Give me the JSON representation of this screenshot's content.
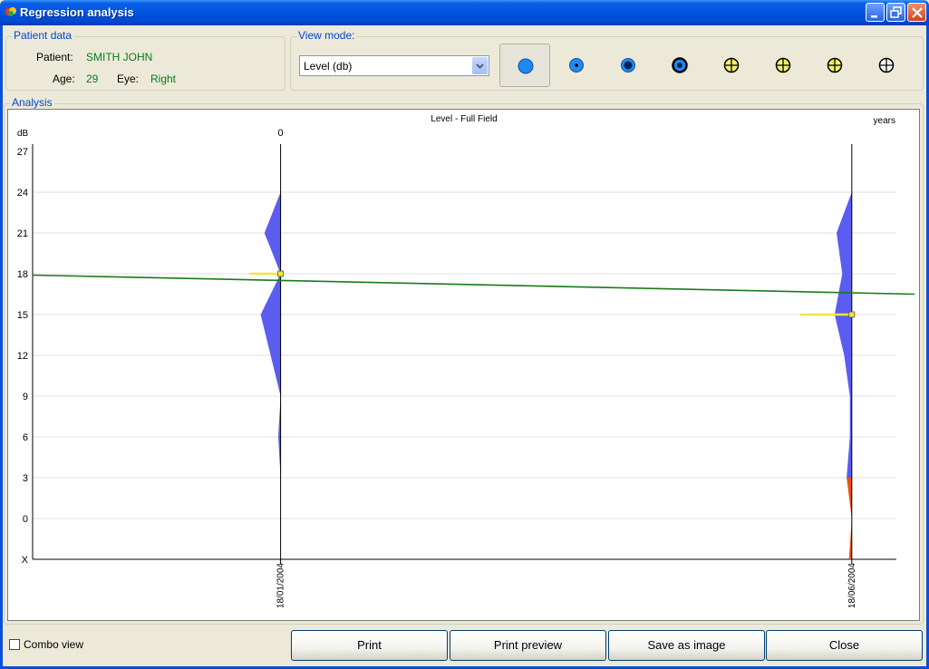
{
  "window": {
    "title": "Regression analysis"
  },
  "patient": {
    "group_label": "Patient data",
    "patient_label": "Patient:",
    "patient_name": "SMITH JOHN",
    "age_label": "Age:",
    "age_value": "29",
    "eye_label": "Eye:",
    "eye_value": "Right"
  },
  "view_mode": {
    "group_label": "View mode:",
    "selected": "Level (db)",
    "icons": [
      "circle-filled-icon",
      "circle-dot-icon",
      "circle-dark-center-icon",
      "circle-black-center-icon",
      "cross-circle-yellow-icon",
      "cross-circle-yellow-icon",
      "cross-circle-yellow-icon",
      "cross-circle-yellow-icon"
    ]
  },
  "analysis": {
    "group_label": "Analysis"
  },
  "chart_data": {
    "type": "line",
    "title": "Level - Full Field",
    "ylabel": "dB",
    "xlabel": "years",
    "top_left_tick": "0",
    "y_ticks": [
      "27",
      "24",
      "21",
      "18",
      "15",
      "12",
      "9",
      "6",
      "3",
      "0",
      "X"
    ],
    "ylim": [
      -3,
      27
    ],
    "grid": true,
    "x_dates": [
      "18/01/2004",
      "18/06/2004"
    ],
    "x_years": [
      0,
      0.41
    ],
    "x_range_years": [
      -0.178,
      0.455
    ],
    "regression_line": {
      "color": "#1a7a1a",
      "y_at_left_edge": 17.9,
      "y_at_right_edge": 16.5
    },
    "series_mean": [
      {
        "date": "18/01/2004",
        "value": 18
      },
      {
        "date": "18/06/2004",
        "value": 15
      }
    ],
    "distributions": [
      {
        "date": "18/01/2004",
        "blue_profile": [
          [
            24,
            0
          ],
          [
            21,
            1.7
          ],
          [
            18,
            0
          ],
          [
            15,
            2.1
          ],
          [
            9,
            0
          ],
          [
            6,
            0.25
          ],
          [
            3,
            0
          ]
        ],
        "orange_profile": []
      },
      {
        "date": "18/06/2004",
        "blue_profile": [
          [
            24,
            0
          ],
          [
            21,
            1.6
          ],
          [
            18,
            1.0
          ],
          [
            15,
            1.8
          ],
          [
            12,
            0.8
          ],
          [
            9,
            0.2
          ],
          [
            6,
            0.2
          ],
          [
            3,
            0.55
          ]
        ],
        "orange_profile": [
          [
            3,
            0.55
          ],
          [
            0,
            0
          ],
          [
            -3,
            0.3
          ]
        ]
      }
    ],
    "colors": {
      "blue": "#5b5cf0",
      "orange": "#e8521a",
      "mean_marker": "#f2e63a"
    }
  },
  "footer": {
    "combo_label": "Combo view",
    "buttons": [
      "Print",
      "Print preview",
      "Save as image",
      "Close"
    ]
  }
}
